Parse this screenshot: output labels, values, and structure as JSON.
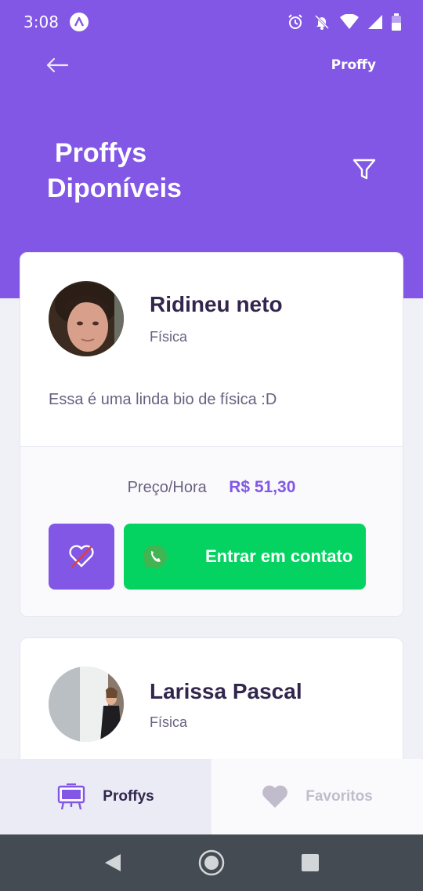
{
  "status_bar": {
    "time": "3:08"
  },
  "header": {
    "brand": "Proffy",
    "title_line1": "Proffys",
    "title_line2": "Diponíveis"
  },
  "teachers": [
    {
      "name": "Ridineu neto",
      "subject": "Física",
      "bio": "Essa é uma linda bio de física :D",
      "price_label": "Preço/Hora",
      "price_value": "R$ 51,30",
      "contact_label": "Entrar em contato",
      "favorited": true
    },
    {
      "name": "Larissa Pascal",
      "subject": "Física"
    }
  ],
  "tabs": [
    {
      "label": "Proffys",
      "icon": "easel-icon",
      "active": true
    },
    {
      "label": "Favoritos",
      "icon": "heart-icon",
      "active": false
    }
  ],
  "colors": {
    "primary": "#8257E5",
    "secondary": "#04D361",
    "title": "#32264D",
    "text": "#6A6180"
  }
}
